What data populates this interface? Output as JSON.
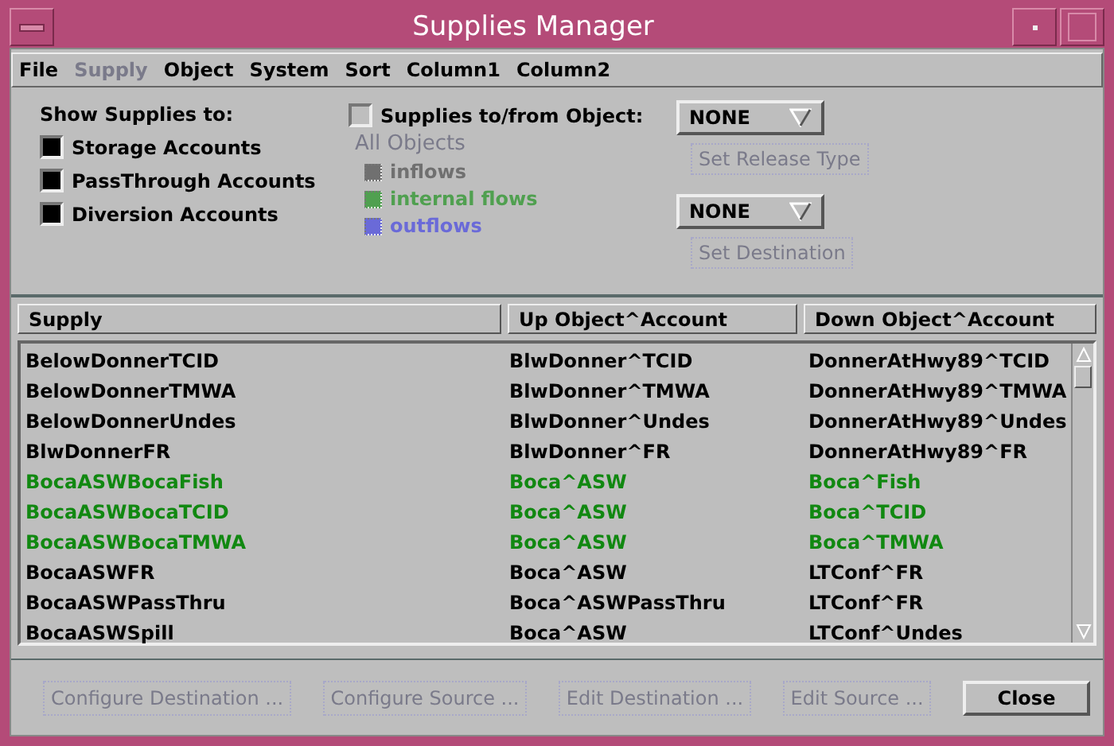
{
  "window": {
    "title": "Supplies Manager"
  },
  "menu": [
    {
      "label": "File",
      "disabled": false
    },
    {
      "label": "Supply",
      "disabled": true
    },
    {
      "label": "Object",
      "disabled": false
    },
    {
      "label": "System",
      "disabled": false
    },
    {
      "label": "Sort",
      "disabled": false
    },
    {
      "label": "Column1",
      "disabled": false
    },
    {
      "label": "Column2",
      "disabled": false
    }
  ],
  "show_supplies": {
    "heading": "Show Supplies to:",
    "options": [
      {
        "label": "Storage Accounts",
        "checked": true
      },
      {
        "label": "PassThrough Accounts",
        "checked": true
      },
      {
        "label": "Diversion Accounts",
        "checked": true
      }
    ]
  },
  "object_filter": {
    "label": "Supplies to/from Object:",
    "checked": false,
    "dropdown": "NONE",
    "release_button": "Set Release Type",
    "group_label": "All Objects",
    "flows": [
      {
        "label": "inflows",
        "checked": true,
        "disabled": true,
        "color": "#707070"
      },
      {
        "label": "internal flows",
        "checked": true,
        "disabled": true,
        "color": "#50a050"
      },
      {
        "label": "outflows",
        "checked": true,
        "disabled": true,
        "color": "#6a6ad8"
      }
    ],
    "destination_dropdown": "NONE",
    "destination_button": "Set Destination"
  },
  "table": {
    "columns": [
      "Supply",
      "Up Object^Account",
      "Down Object^Account"
    ],
    "rows": [
      {
        "cells": [
          "BelowDonnerTCID",
          "BlwDonner^TCID",
          "DonnerAtHwy89^TCID"
        ],
        "color": "#000000"
      },
      {
        "cells": [
          "BelowDonnerTMWA",
          "BlwDonner^TMWA",
          "DonnerAtHwy89^TMWA"
        ],
        "color": "#000000"
      },
      {
        "cells": [
          "BelowDonnerUndes",
          "BlwDonner^Undes",
          "DonnerAtHwy89^Undes"
        ],
        "color": "#000000"
      },
      {
        "cells": [
          "BlwDonnerFR",
          "BlwDonner^FR",
          "DonnerAtHwy89^FR"
        ],
        "color": "#000000"
      },
      {
        "cells": [
          "BocaASWBocaFish",
          "Boca^ASW",
          "Boca^Fish"
        ],
        "color": "#118811"
      },
      {
        "cells": [
          "BocaASWBocaTCID",
          "Boca^ASW",
          "Boca^TCID"
        ],
        "color": "#118811"
      },
      {
        "cells": [
          "BocaASWBocaTMWA",
          "Boca^ASW",
          "Boca^TMWA"
        ],
        "color": "#118811"
      },
      {
        "cells": [
          "BocaASWFR",
          "Boca^ASW",
          "LTConf^FR"
        ],
        "color": "#000000"
      },
      {
        "cells": [
          "BocaASWPassThru",
          "Boca^ASWPassThru",
          "LTConf^FR"
        ],
        "color": "#000000"
      },
      {
        "cells": [
          "BocaASWSpill",
          "Boca^ASW",
          "LTConf^Undes"
        ],
        "color": "#000000"
      }
    ]
  },
  "buttons": [
    {
      "label": "Configure Destination ...",
      "disabled": true
    },
    {
      "label": "Configure Source ...",
      "disabled": true
    },
    {
      "label": "Edit Destination ...",
      "disabled": true
    },
    {
      "label": "Edit Source ...",
      "disabled": true
    },
    {
      "label": "Close",
      "disabled": false
    }
  ]
}
